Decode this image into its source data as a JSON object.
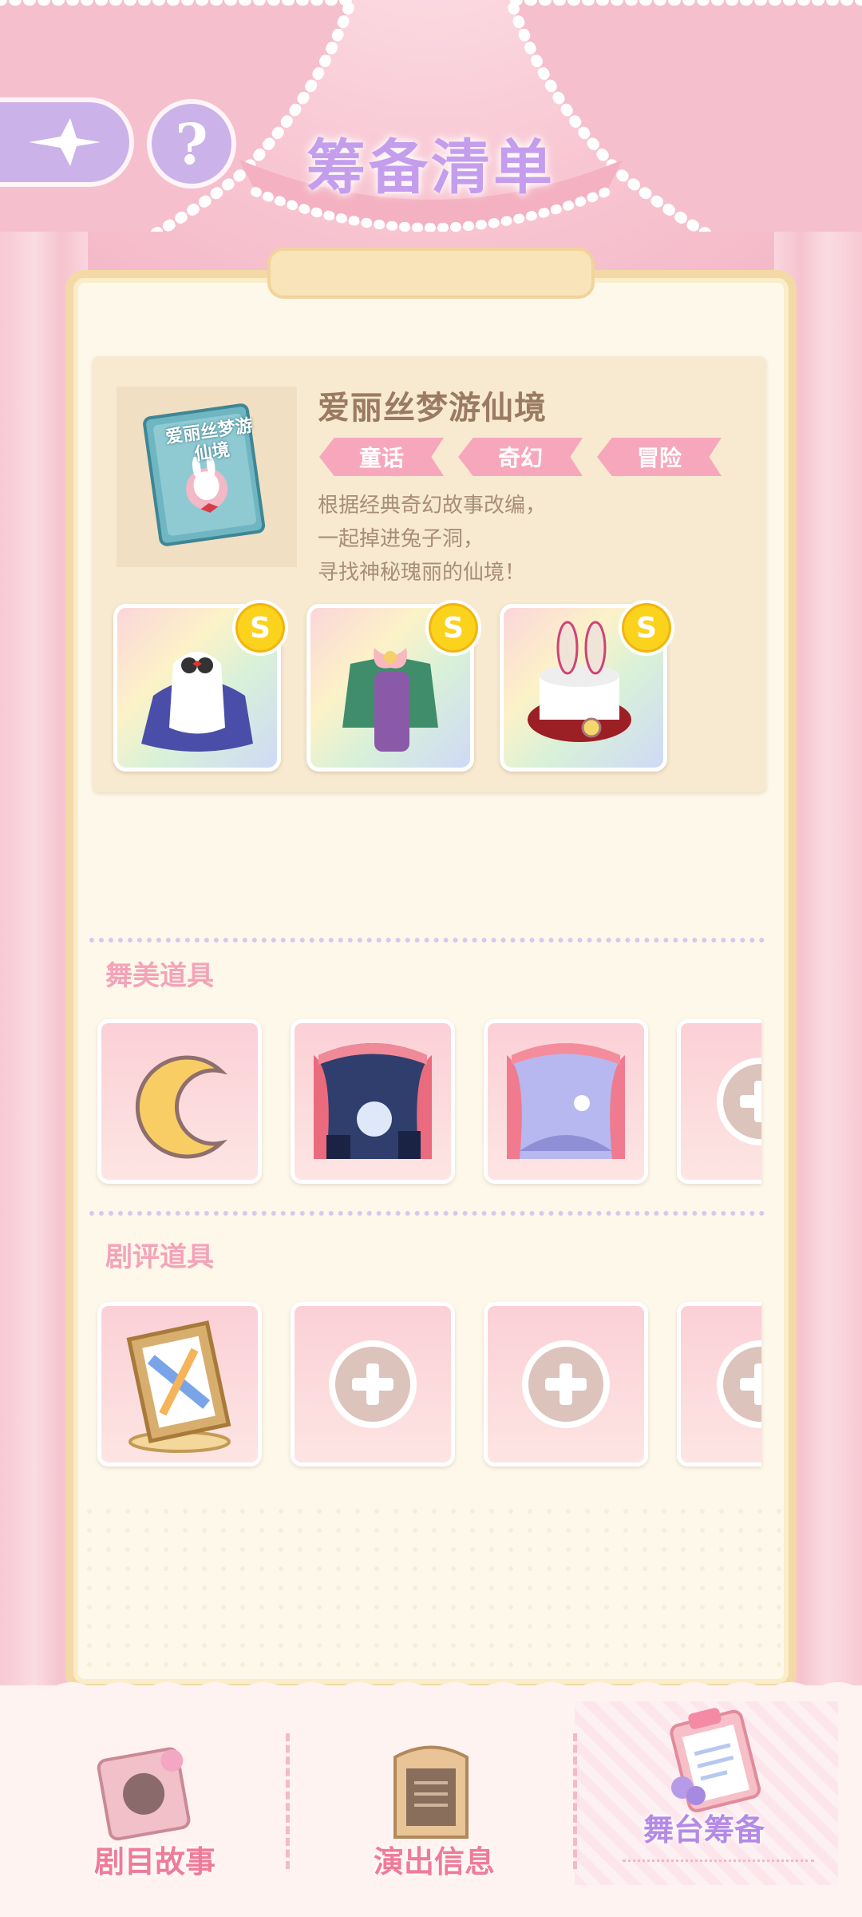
{
  "header": {
    "title": "筹备清单",
    "help_symbol": "?"
  },
  "story": {
    "title": "爱丽丝梦游仙境",
    "cover_text": "爱丽丝梦游仙境",
    "tags": [
      "童话",
      "奇幻",
      "冒险"
    ],
    "description": "根据经典奇幻故事改编，\n一起掉进兔子洞，\n寻找神秘瑰丽的仙境！",
    "outfits": [
      {
        "icon": "rabbit-dress-icon",
        "badge": "S"
      },
      {
        "icon": "green-suit-icon",
        "badge": "S"
      },
      {
        "icon": "rabbit-top-hat-icon",
        "badge": "S"
      }
    ]
  },
  "stage_props": {
    "title": "舞美道具",
    "items": [
      {
        "icon": "crescent-moon-icon"
      },
      {
        "icon": "night-stage-icon"
      },
      {
        "icon": "wonderland-stage-icon"
      },
      {
        "icon": "add-slot-icon"
      }
    ]
  },
  "review_props": {
    "title": "剧评道具",
    "items": [
      {
        "icon": "card-frame-icon"
      },
      {
        "icon": "add-slot-icon"
      },
      {
        "icon": "add-slot-icon"
      },
      {
        "icon": "add-slot-icon"
      }
    ]
  },
  "bottom_nav": {
    "items": [
      {
        "label": "剧目故事",
        "icon": "storybook-icon"
      },
      {
        "label": "演出信息",
        "icon": "notice-board-icon"
      },
      {
        "label": "舞台筹备",
        "icon": "clipboard-icon",
        "active": true
      }
    ]
  },
  "colors": {
    "accent_purple": "#c59ded",
    "accent_pink": "#ef7b97",
    "tag_pink": "#f7a7bc",
    "coin_gold": "#fbd21c"
  }
}
